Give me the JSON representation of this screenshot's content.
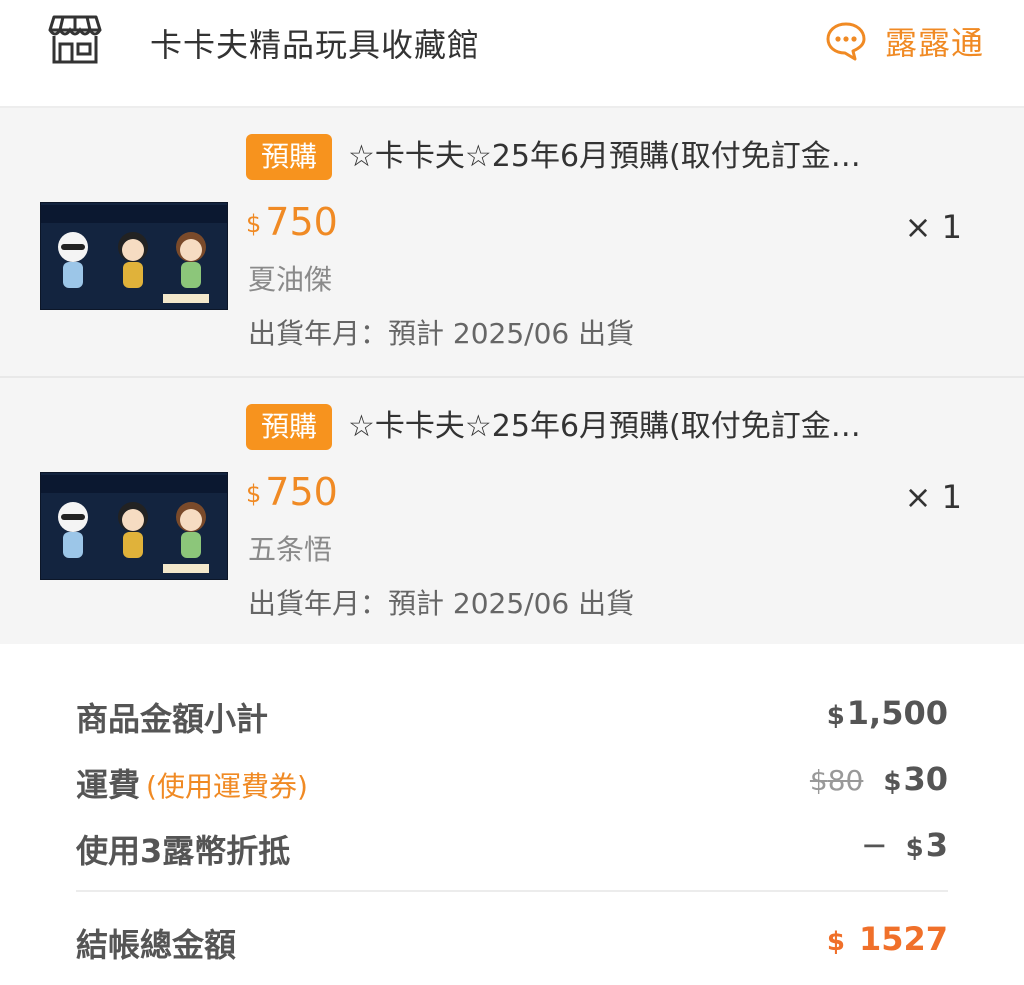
{
  "header": {
    "store_name": "卡卡夫精品玩具收藏館",
    "chat_label": "露露通"
  },
  "items": [
    {
      "badge": "預購",
      "title": "☆卡卡夫☆25年6月預購(取付免訂金…",
      "currency": "$",
      "price": "750",
      "qty": "× 1",
      "variant": "夏油傑",
      "ship": "出貨年月：預計 2025/06 出貨"
    },
    {
      "badge": "預購",
      "title": "☆卡卡夫☆25年6月預購(取付免訂金…",
      "currency": "$",
      "price": "750",
      "qty": "× 1",
      "variant": "五条悟",
      "ship": "出貨年月：預計 2025/06 出貨"
    }
  ],
  "summary": {
    "subtotal_label": "商品金額小計",
    "subtotal_value": "1,500",
    "shipping_label": "運費",
    "shipping_note": "(使用運費券)",
    "shipping_old": "80",
    "shipping_value": "30",
    "coin_label": "使用3露幣折抵",
    "coin_value": "3",
    "total_label": "結帳總金額",
    "total_value": "1527",
    "currency": "$",
    "minus": "−"
  },
  "colors": {
    "accent": "#f08a24",
    "badge": "#f7931e",
    "total": "#f0702a"
  },
  "icons": {
    "store": "store-icon",
    "chat": "chat-bubble-icon"
  }
}
